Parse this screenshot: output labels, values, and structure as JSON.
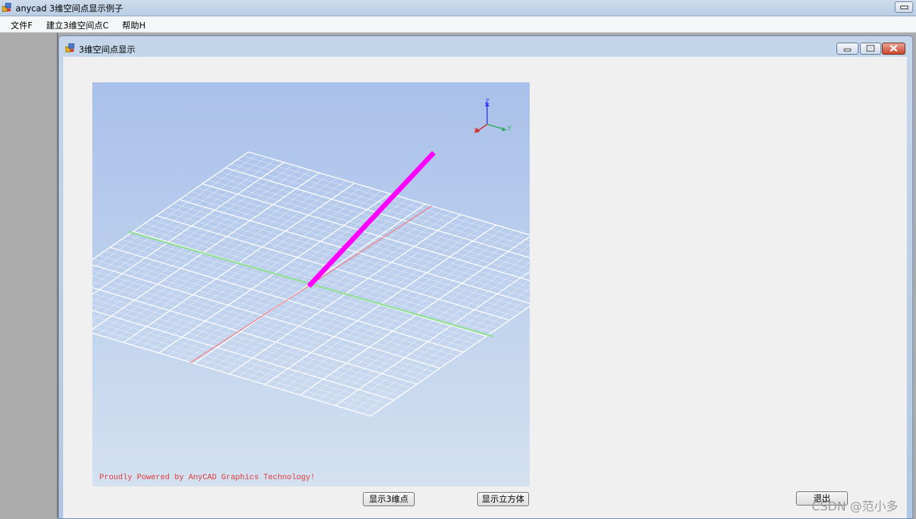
{
  "app": {
    "title": "anycad 3维空间点显示例子"
  },
  "menu": {
    "items": [
      "文件F",
      "建立3维空间点C",
      "帮助H"
    ]
  },
  "child_window": {
    "title": "3维空间点显示"
  },
  "viewport": {
    "axis_labels": {
      "x": "X",
      "y": "Y",
      "z": "Z"
    },
    "footer": "Proudly Powered by AnyCAD Graphics Technology!",
    "colors": {
      "bg_top": "#a9c0ea",
      "bg_bottom": "#d3e1f0",
      "line": "#ff00ff",
      "x_axis": "#ff6b6b",
      "y_axis": "#8fe08f",
      "grid": "#ffffff"
    }
  },
  "buttons": {
    "show_points": "显示3维点",
    "show_cube": "显示立方体",
    "exit": "退出"
  },
  "watermark": "CSDN @范小多"
}
